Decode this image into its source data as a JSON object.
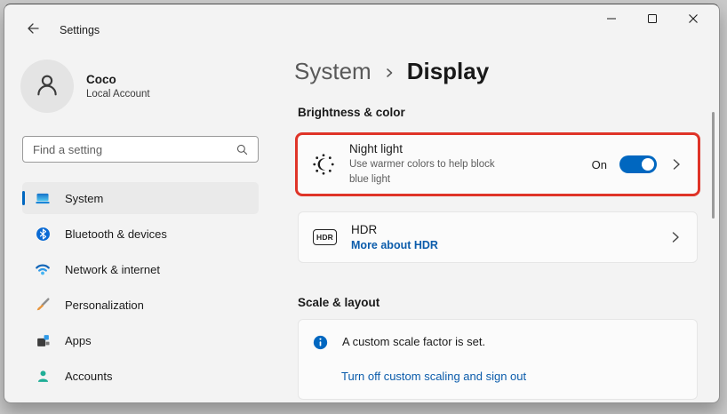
{
  "titlebar": {
    "title": "Settings"
  },
  "sidebar": {
    "user": {
      "name": "Coco",
      "subtitle": "Local Account"
    },
    "search_placeholder": "Find a setting",
    "items": [
      {
        "label": "System",
        "selected": true
      },
      {
        "label": "Bluetooth & devices",
        "selected": false
      },
      {
        "label": "Network & internet",
        "selected": false
      },
      {
        "label": "Personalization",
        "selected": false
      },
      {
        "label": "Apps",
        "selected": false
      },
      {
        "label": "Accounts",
        "selected": false
      }
    ]
  },
  "main": {
    "breadcrumb": {
      "parent": "System",
      "current": "Display"
    },
    "section_brightness": "Brightness & color",
    "night_light": {
      "title": "Night light",
      "description_line1": "Use warmer colors to help block",
      "description_line2": "blue light",
      "toggle_label": "On",
      "toggle_on": true
    },
    "hdr": {
      "badge": "HDR",
      "title": "HDR",
      "link": "More about HDR"
    },
    "section_scale": "Scale & layout",
    "scale_notice": {
      "message": "A custom scale factor is set.",
      "link": "Turn off custom scaling and sign out"
    }
  },
  "colors": {
    "accent": "#0067c0",
    "link": "#0b5cab",
    "highlight_red": "#df3428",
    "window_bg": "#f3f3f3",
    "card_bg": "#fbfbfb"
  }
}
